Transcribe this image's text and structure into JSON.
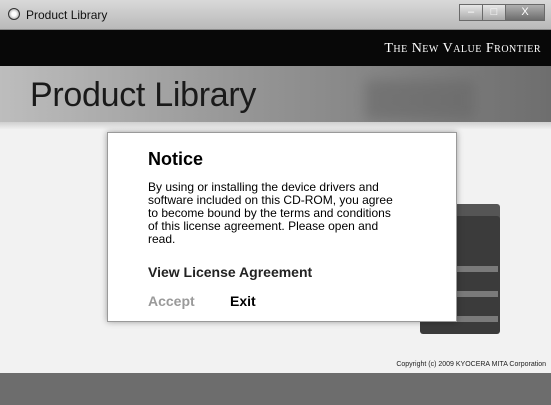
{
  "window": {
    "title": "Product Library",
    "buttons": {
      "minimize": "–",
      "maximize": "□",
      "close": "X"
    }
  },
  "banner": {
    "tagline": "The New Value Frontier"
  },
  "header": {
    "title": "Product Library"
  },
  "notice": {
    "title": "Notice",
    "body": "By using or installing the device drivers and software included on this CD-ROM, you agree to become bound by the terms and conditions of this license agreement. Please open and read.",
    "link": "View License Agreement",
    "accept": "Accept",
    "exit": "Exit"
  },
  "footer": {
    "copyright": "Copyright (c) 2009 KYOCERA MITA Corporation"
  },
  "colors": {
    "accent_disabled": "#9a9a9a",
    "banner": "#080808"
  }
}
